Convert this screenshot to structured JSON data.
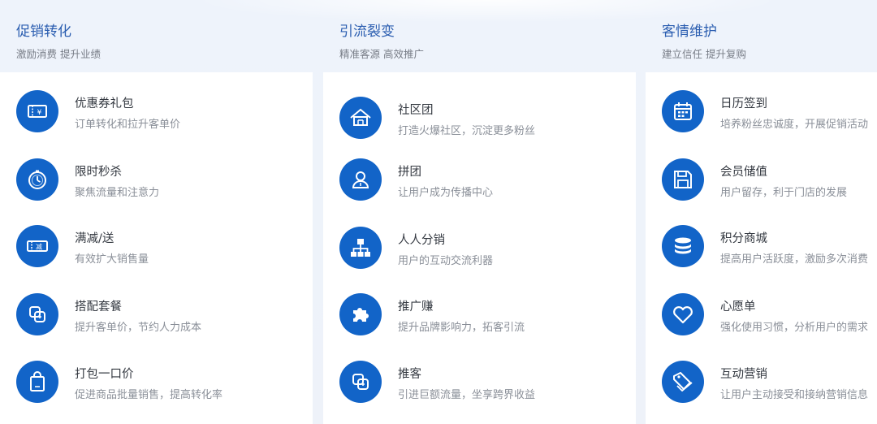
{
  "colors": {
    "accent": "#1264c8",
    "title": "#2a5db0",
    "card": "#ffffff",
    "background": "#eef3fb"
  },
  "sections": [
    {
      "title": "促销转化",
      "subtitle": "激励消费 提升业绩",
      "items": [
        {
          "name": "优惠券礼包",
          "desc": "订单转化和拉升客单价",
          "icon": "coupon-icon"
        },
        {
          "name": "限时秒杀",
          "desc": "聚焦流量和注意力",
          "icon": "stopwatch-icon"
        },
        {
          "name": "满减/送",
          "desc": "有效扩大销售量",
          "icon": "discount-ticket-icon",
          "icon_text": "减"
        },
        {
          "name": "搭配套餐",
          "desc": "提升客单价，节约人力成本",
          "icon": "bundle-icon"
        },
        {
          "name": "打包一口价",
          "desc": "促进商品批量销售，提高转化率",
          "icon": "shopping-bag-icon"
        }
      ]
    },
    {
      "title": "引流裂变",
      "subtitle": "精准客源 高效推广",
      "items": [
        {
          "name": "社区团",
          "desc": "打造火爆社区，沉淀更多粉丝",
          "icon": "community-icon"
        },
        {
          "name": "拼团",
          "desc": "让用户成为传播中心",
          "icon": "user-icon"
        },
        {
          "name": "人人分销",
          "desc": "用户的互动交流利器",
          "icon": "network-icon"
        },
        {
          "name": "推广赚",
          "desc": "提升品牌影响力，拓客引流",
          "icon": "puzzle-icon"
        },
        {
          "name": "推客",
          "desc": "引进巨额流量，坐享跨界收益",
          "icon": "share-icon"
        }
      ]
    },
    {
      "title": "客情维护",
      "subtitle": "建立信任 提升复购",
      "items": [
        {
          "name": "日历签到",
          "desc": "培养粉丝忠诚度，开展促销活动",
          "icon": "calendar-icon"
        },
        {
          "name": "会员储值",
          "desc": "用户留存，利于门店的发展",
          "icon": "save-icon"
        },
        {
          "name": "积分商城",
          "desc": "提高用户活跃度，激励多次消费",
          "icon": "coins-icon"
        },
        {
          "name": "心愿单",
          "desc": "强化使用习惯，分析用户的需求",
          "icon": "heart-icon"
        },
        {
          "name": "互动营销",
          "desc": "让用户主动接受和接纳营销信息",
          "icon": "tags-icon"
        }
      ]
    }
  ]
}
